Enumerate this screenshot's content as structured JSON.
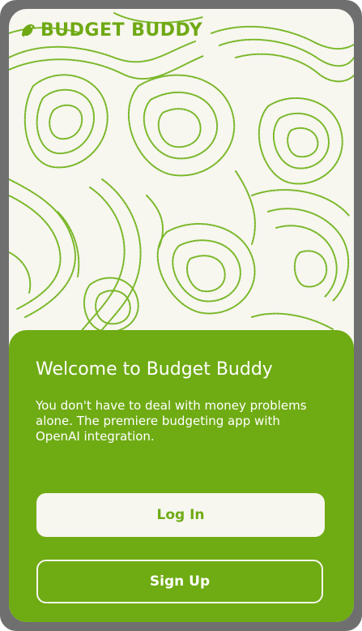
{
  "app": {
    "brand_name": "BUDGET BUDDY",
    "brand_icon": "bird-icon"
  },
  "welcome": {
    "title": "Welcome to Budget Buddy",
    "description": "You don't have to deal with money problems alone. The premiere budgeting app with OpenAI integration."
  },
  "actions": {
    "login_label": "Log In",
    "signup_label": "Sign Up"
  },
  "colors": {
    "accent": "#6fab13",
    "background": "#f7f6ef",
    "contour": "#7ab82a",
    "frame": "#6f6f6f"
  }
}
